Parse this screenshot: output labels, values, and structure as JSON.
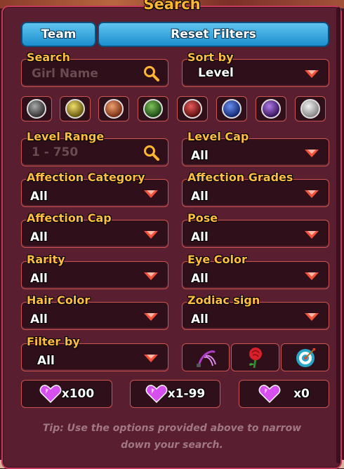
{
  "panel": {
    "title": "Search"
  },
  "tabs": {
    "team": "Team",
    "reset": "Reset Filters"
  },
  "search": {
    "label": "Search",
    "placeholder": "Girl Name"
  },
  "sort_by": {
    "label": "Sort by",
    "value": "Level"
  },
  "elements": [
    "darkness",
    "light",
    "dominatrix",
    "nature",
    "fire",
    "water",
    "psychic",
    "stone"
  ],
  "level_range": {
    "label": "Level Range",
    "placeholder": "1 - 750"
  },
  "level_cap": {
    "label": "Level Cap",
    "value": "All"
  },
  "affection_category": {
    "label": "Affection Category",
    "value": "All"
  },
  "affection_grades": {
    "label": "Affection Grades",
    "value": "All"
  },
  "affection_cap": {
    "label": "Affection Cap",
    "value": "All"
  },
  "pose": {
    "label": "Pose",
    "value": "All"
  },
  "rarity": {
    "label": "Rarity",
    "value": "All"
  },
  "eye_color": {
    "label": "Eye Color",
    "value": "All"
  },
  "hair_color": {
    "label": "Hair Color",
    "value": "All"
  },
  "zodiac": {
    "label": "Zodiac sign",
    "value": "All"
  },
  "filter_by": {
    "label": "Filter by",
    "value": "All"
  },
  "preferences": {
    "icons": [
      "whip-icon",
      "rose-icon",
      "target-icon"
    ]
  },
  "affection_buttons": [
    "x100",
    "x1-99",
    "x0"
  ],
  "tip": "Tip: Use the options provided above to narrow down your search.",
  "colors": {
    "accent": "#ffbd3f",
    "frame": "#c43a5a",
    "panel": "#5a1e31",
    "tab": "#1c8fcf"
  }
}
